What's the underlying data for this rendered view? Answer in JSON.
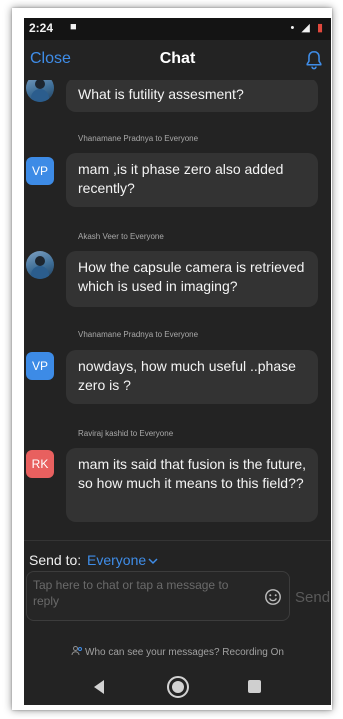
{
  "status": {
    "time": "2:24",
    "left_glyph": "■",
    "right_glyph": "• ◢",
    "battery_icon": "battery-low-icon"
  },
  "header": {
    "close_label": "Close",
    "title": "Chat",
    "bell_icon": "bell-icon"
  },
  "messages": [
    {
      "sender": "",
      "text": "What is futility assesment?",
      "avatar": "photo"
    },
    {
      "sender": "Vhanamane Pradnya to Everyone",
      "text": "mam ,is it phase zero also added recently?",
      "avatar": "VP"
    },
    {
      "sender": "Akash Veer to Everyone",
      "text": "How the capsule camera is retrieved which is used in imaging?",
      "avatar": "photo"
    },
    {
      "sender": "Vhanamane Pradnya to Everyone",
      "text": "nowdays, how much useful ..phase zero is ?",
      "avatar": "VP"
    },
    {
      "sender": "Raviraj kashid to Everyone",
      "text": "mam its said that fusion is the future, so how much it means to this field??",
      "avatar": "RK"
    }
  ],
  "compose": {
    "send_to_label": "Send to:",
    "recipient": "Everyone",
    "placeholder": "Tap here to chat or tap a message to reply",
    "send_label": "Send"
  },
  "footer": {
    "privacy_text": "Who can see your messages? Recording On"
  },
  "colors": {
    "accent": "#3f8de8",
    "vp_avatar": "#3d8be6",
    "rk_avatar": "#e8605f",
    "bubble": "#333333",
    "background": "#232323"
  }
}
